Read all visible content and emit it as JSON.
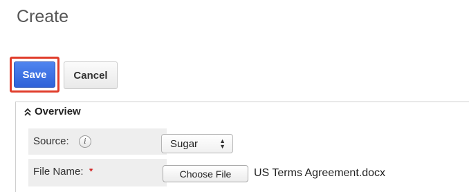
{
  "page": {
    "title": "Create"
  },
  "toolbar": {
    "save_label": "Save",
    "cancel_label": "Cancel"
  },
  "panel": {
    "header": "Overview",
    "source": {
      "label": "Source:",
      "info_icon": "i",
      "value": "Sugar"
    },
    "file_name": {
      "label": "File Name:",
      "required_mark": "*",
      "button_label": "Choose File",
      "selected_file": "US Terms Agreement.docx"
    }
  },
  "colors": {
    "save_button": "#3366e0",
    "highlight": "#e03c2a",
    "required": "#cc0000"
  },
  "icons": {
    "collapse": "double-chevron-up-icon",
    "info": "info-icon",
    "select": "updown-arrows-icon"
  }
}
